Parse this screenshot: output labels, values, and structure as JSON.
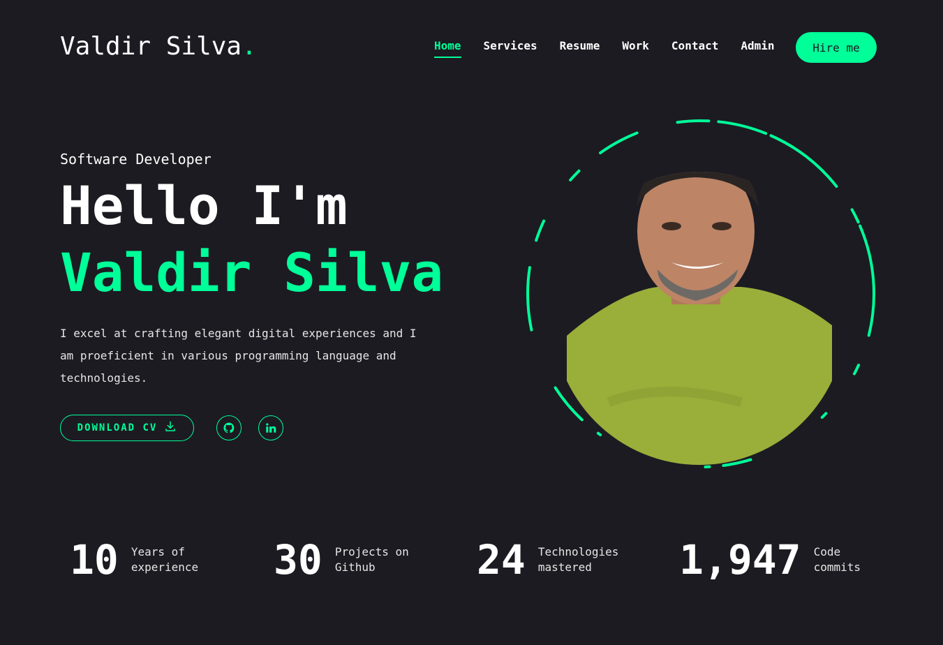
{
  "brand": {
    "name": "Valdir Silva",
    "dot": "."
  },
  "nav": {
    "items": [
      "Home",
      "Services",
      "Resume",
      "Work",
      "Contact",
      "Admin"
    ],
    "active": "Home",
    "hire_label": "Hire me"
  },
  "hero": {
    "role": "Software Developer",
    "greeting": "Hello I'm",
    "name": "Valdir Silva",
    "description": "I excel at crafting elegant digital experiences and I am proeficient in various programming language and technologies.",
    "cv_label": "DOWNLOAD CV",
    "social": [
      "github-icon",
      "linkedin-icon"
    ]
  },
  "stats": [
    {
      "value": "10",
      "label": "Years of experience"
    },
    {
      "value": "30",
      "label": "Projects on Github"
    },
    {
      "value": "24",
      "label": "Technologies mastered"
    },
    {
      "value": "1,947",
      "label": "Code commits"
    }
  ],
  "colors": {
    "accent": "#00ff99",
    "background": "#1c1b22",
    "text": "#ffffff",
    "shirt": "#9aae3a"
  }
}
